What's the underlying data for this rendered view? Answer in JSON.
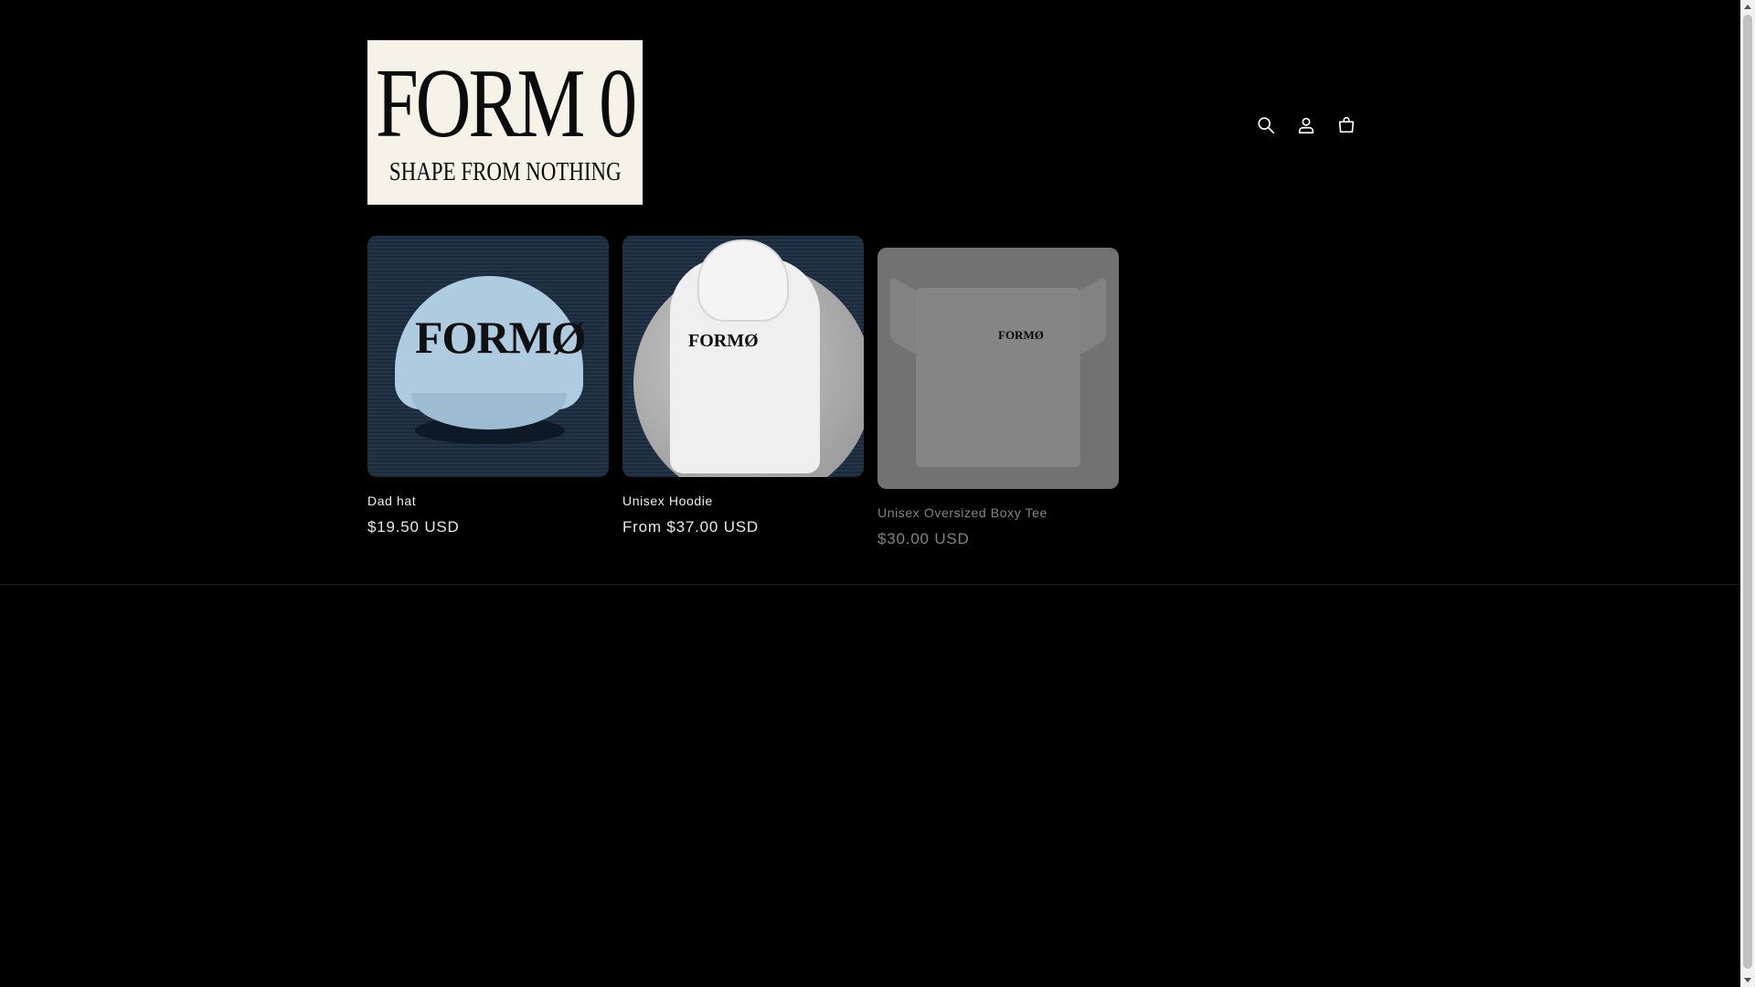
{
  "store": {
    "logo_title": "FORM 0",
    "logo_subtitle": "SHAPE FROM NOTHING"
  },
  "header": {
    "icons": [
      "search-icon",
      "account-icon",
      "cart-icon"
    ]
  },
  "products": [
    {
      "title": "Dad hat",
      "price": "$19.50 USD",
      "print": "FORMØ"
    },
    {
      "title": "Unisex Hoodie",
      "price": "From $37.00 USD",
      "print": "FORMØ"
    },
    {
      "title": "Unisex Oversized Boxy Tee",
      "price": "$30.00 USD",
      "print": "FORMØ"
    }
  ],
  "colors": {
    "background": "#000000",
    "logo_bg": "#f6f2e8",
    "hat": "#aecbe0"
  }
}
